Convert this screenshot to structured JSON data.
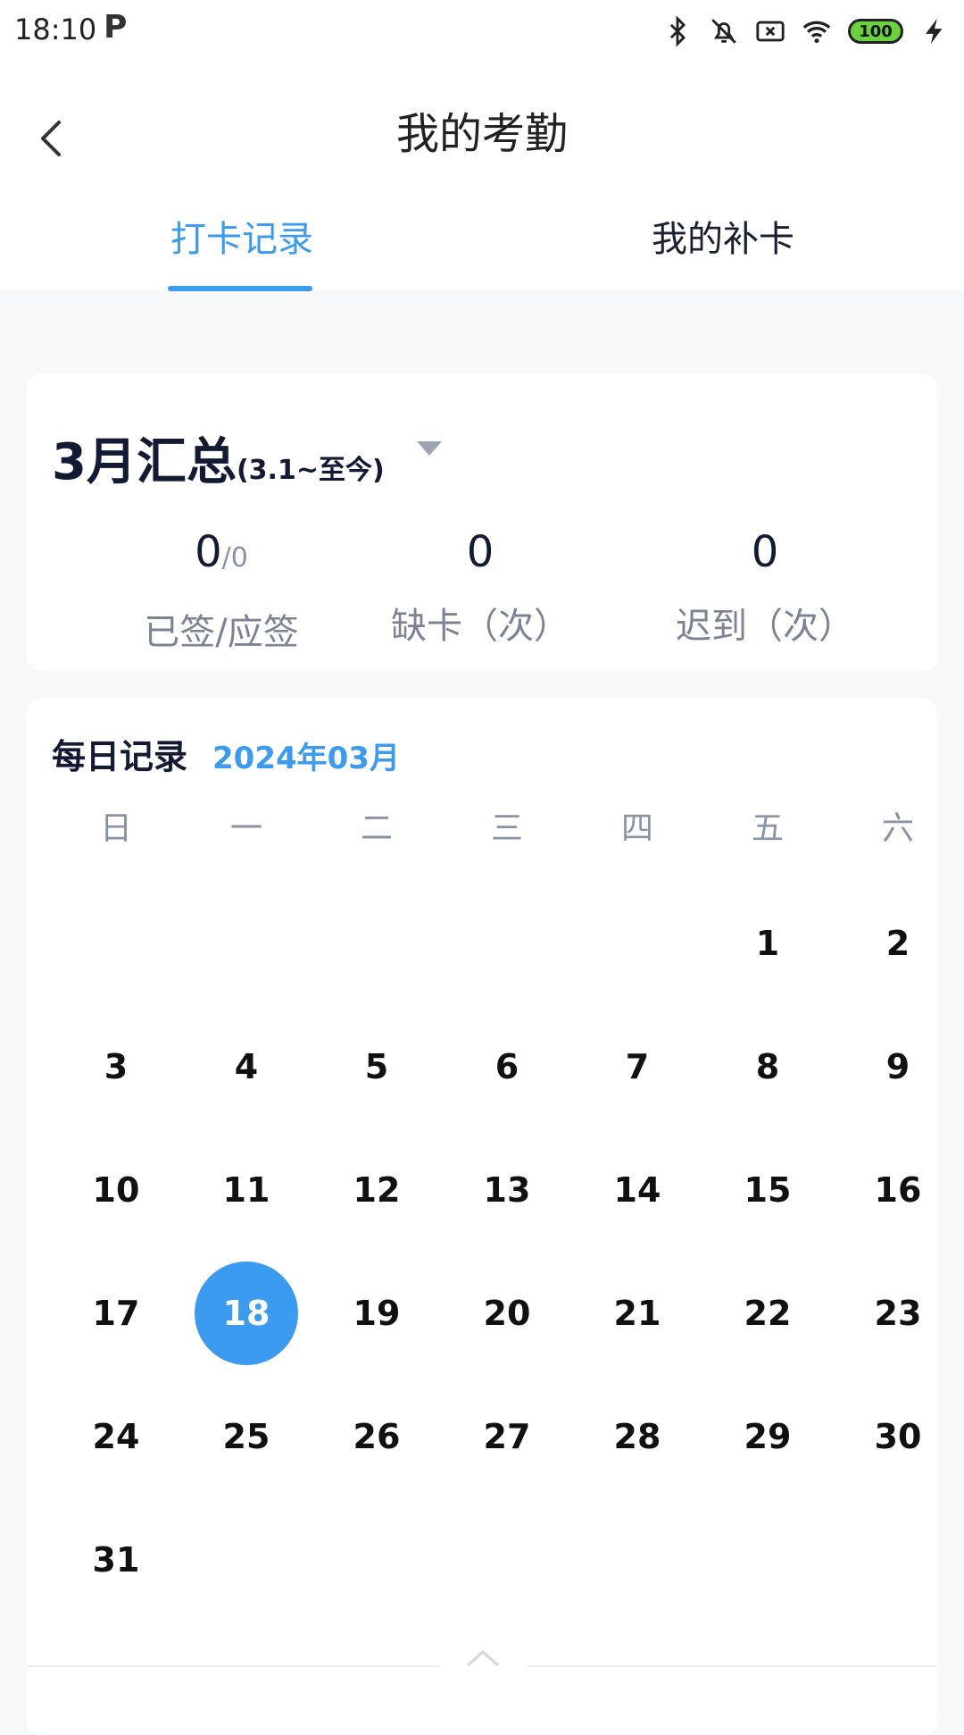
{
  "status_bar": {
    "time": "18:10",
    "app_icon": "P",
    "battery": "100",
    "icons": [
      "bluetooth-icon",
      "bell-off-icon",
      "sim-x-icon",
      "wifi-icon",
      "battery-icon",
      "charging-icon"
    ]
  },
  "header": {
    "title": "我的考勤",
    "tabs": [
      {
        "label": "打卡记录",
        "active": true
      },
      {
        "label": "我的补卡",
        "active": false
      }
    ]
  },
  "summary": {
    "title": "3月汇总",
    "range": "(3.1~至今)",
    "stats": [
      {
        "value": "0",
        "sub": "/0",
        "label": "已签/应签"
      },
      {
        "value": "0",
        "label": "缺卡（次）"
      },
      {
        "value": "0",
        "label": "迟到（次）"
      }
    ]
  },
  "calendar": {
    "title": "每日记录",
    "month": "2024年03月",
    "weekdays": [
      "日",
      "一",
      "二",
      "三",
      "四",
      "五",
      "六"
    ],
    "first_weekday_index": 5,
    "days_in_month": 31,
    "selected_day": 18
  },
  "colors": {
    "accent": "#3a9bf0",
    "title_text": "#131a33",
    "muted_text": "#8a93a6",
    "background": "#f7f8fa"
  }
}
